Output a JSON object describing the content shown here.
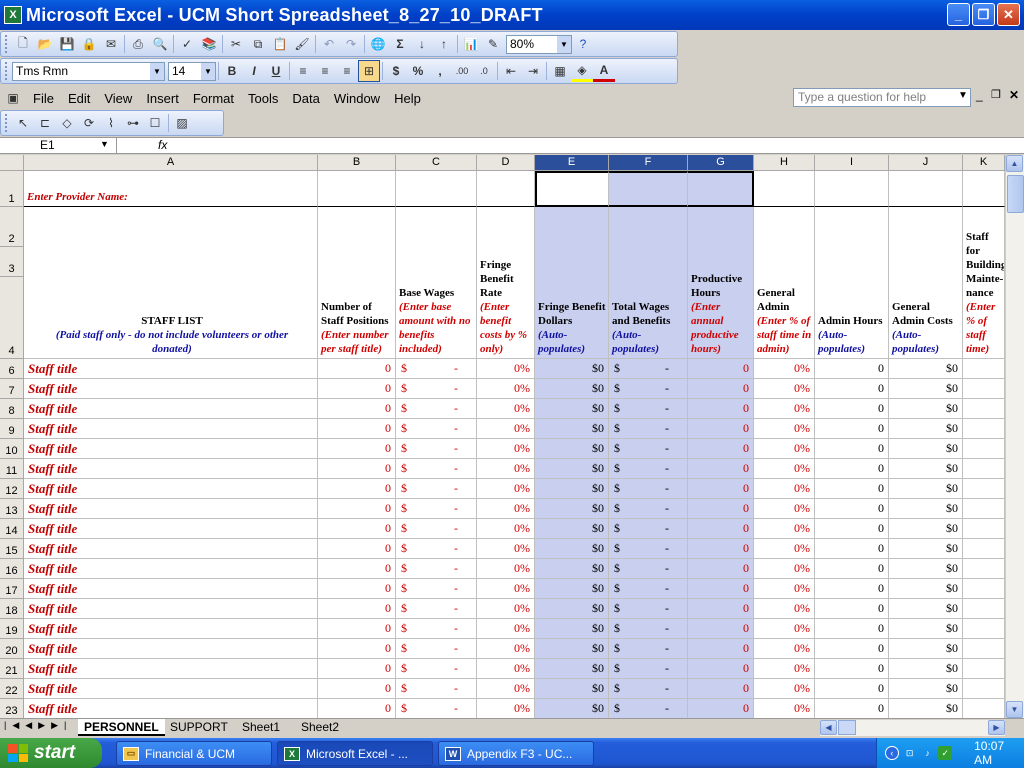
{
  "window": {
    "title": "Microsoft Excel - UCM Short Spreadsheet_8_27_10_DRAFT",
    "app_icon": "excel-icon"
  },
  "toolbar": {
    "zoom": "80%",
    "sigma": "Σ"
  },
  "format_toolbar": {
    "font": "Tms Rmn",
    "size": "14",
    "bold": "B",
    "italic": "I",
    "underline": "U",
    "currency": "$",
    "percent": "%",
    "comma": ",",
    "inc_dec": ".00",
    "dec_dec": ".0"
  },
  "menu": [
    "File",
    "Edit",
    "View",
    "Insert",
    "Format",
    "Tools",
    "Data",
    "Window",
    "Help"
  ],
  "help_placeholder": "Type a question for help",
  "namebox": "E1",
  "fx": "fx",
  "columns": [
    "A",
    "B",
    "C",
    "D",
    "E",
    "F",
    "G",
    "H",
    "I",
    "J",
    "K"
  ],
  "row_header_labels": [
    "1",
    "2",
    "3",
    "4"
  ],
  "provider_label": "Enter Provider Name:",
  "headers": {
    "a_title": "STAFF LIST",
    "a_sub": "(Paid staff only - do not include volunteers or other donated)",
    "b_title": "Number of Staff Positions",
    "b_sub": "(Enter number per staff title)",
    "c_title": "Base Wages",
    "c_sub": "(Enter base amount with no benefits included)",
    "d_title": "Fringe Benefit Rate",
    "d_sub": "(Enter benefit costs by % only)",
    "e_title": "Fringe Benefit Dollars",
    "e_sub": "(Auto-populates)",
    "f_title": "Total Wages and Benefits",
    "f_sub": "(Auto-populates)",
    "g_title": "Productive Hours",
    "g_sub": "(Enter annual productive hours)",
    "h_title": "General Admin",
    "h_sub": "(Enter % of staff time in admin)",
    "i_title": "Admin Hours",
    "i_sub": "(Auto-populates)",
    "j_title": "General Admin Costs",
    "j_sub": "(Auto-populates)",
    "k_title": "Staff for Building Mainte-nance",
    "k_sub": "(Enter % of staff time)"
  },
  "row_numbers": [
    "6",
    "7",
    "8",
    "9",
    "10",
    "11",
    "12",
    "13",
    "14",
    "15",
    "16",
    "17",
    "18",
    "19",
    "20",
    "21",
    "22",
    "23"
  ],
  "row_values": {
    "staff": "Staff title",
    "b": "0",
    "c_sign": "$",
    "c_dash": "-",
    "d": "0%",
    "e": "$0",
    "f_sign": "$",
    "f_dash": "-",
    "g": "0",
    "h": "0%",
    "i": "0",
    "j": "$0"
  },
  "sheets": [
    "PERSONNEL",
    "SUPPORT",
    "Sheet1",
    "Sheet2"
  ],
  "taskbar": {
    "start": "start",
    "tasks": [
      "Financial & UCM",
      "Microsoft Excel - ...",
      "Appendix F3 - UC..."
    ],
    "clock": "10:07 AM"
  },
  "colors": {
    "title_blue": "#0a5fe0",
    "selected_col": "#2b4f9b",
    "shade": "#c9cfee",
    "red_text": "#d00000",
    "blue_text": "#1010a0"
  }
}
